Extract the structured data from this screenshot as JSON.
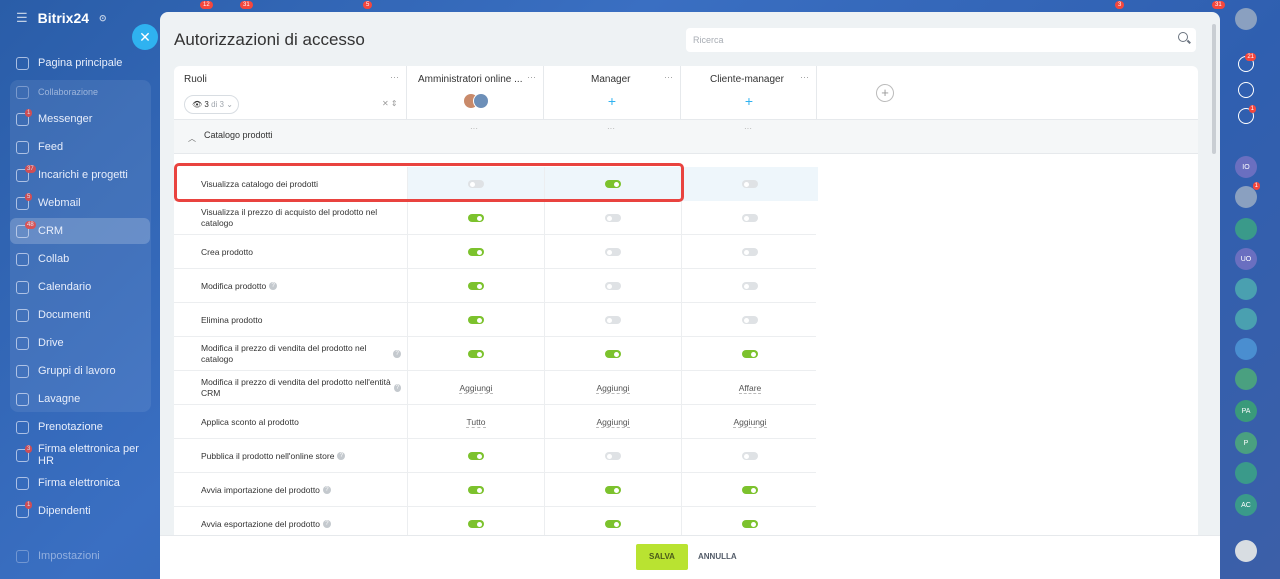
{
  "brand": {
    "name": "Bitrix24",
    "clock_mark": "⊙"
  },
  "nav": [
    {
      "label": "Pagina principale",
      "icon": "home-icon"
    },
    {
      "label": "Collaborazione",
      "icon": "collab-group-icon",
      "sub": true
    },
    {
      "label": "Messenger",
      "icon": "chat-icon",
      "badge": "1"
    },
    {
      "label": "Feed",
      "icon": "feed-icon"
    },
    {
      "label": "Incarichi e progetti",
      "icon": "tasks-icon",
      "badge": "37"
    },
    {
      "label": "Webmail",
      "icon": "mail-icon",
      "badge": "5"
    },
    {
      "label": "CRM",
      "icon": "crm-icon",
      "badge": "48",
      "active": true
    },
    {
      "label": "Collab",
      "icon": "collab-icon"
    },
    {
      "label": "Calendario",
      "icon": "calendar-icon"
    },
    {
      "label": "Documenti",
      "icon": "documents-icon"
    },
    {
      "label": "Drive",
      "icon": "drive-icon"
    },
    {
      "label": "Gruppi di lavoro",
      "icon": "groups-icon"
    },
    {
      "label": "Lavagne",
      "icon": "boards-icon"
    },
    {
      "label": "Prenotazione",
      "icon": "booking-icon"
    },
    {
      "label": "Firma elettronica per HR",
      "icon": "hr-sign-icon",
      "badge": "3"
    },
    {
      "label": "Firma elettronica",
      "icon": "sign-icon"
    },
    {
      "label": "Dipendenti",
      "icon": "employees-icon",
      "badge": "1"
    },
    {
      "label": "Impostazioni",
      "icon": "settings-icon",
      "dim": true
    }
  ],
  "topbar_badges": [
    "12",
    "31",
    "5",
    "3",
    "31"
  ],
  "panel": {
    "title": "Autorizzazioni di accesso",
    "search_placeholder": "Ricerca",
    "roles_header": "Ruoli",
    "roles_count": "3",
    "roles_of": "di 3",
    "columns": [
      {
        "label": "Amministratori online ...",
        "kind": "avatars"
      },
      {
        "label": "Manager",
        "kind": "add"
      },
      {
        "label": "Cliente-manager",
        "kind": "add"
      }
    ],
    "section": "Catalogo prodotti",
    "rows": [
      {
        "name": "Visualizza catalogo dei prodotti",
        "info": false,
        "values": [
          "off",
          "on",
          "off"
        ],
        "highlight": true
      },
      {
        "name": "Visualizza il prezzo di acquisto del prodotto nel catalogo",
        "info": false,
        "values": [
          "on",
          "off",
          "off"
        ]
      },
      {
        "name": "Crea prodotto",
        "info": false,
        "values": [
          "on",
          "off",
          "off"
        ]
      },
      {
        "name": "Modifica prodotto",
        "info": true,
        "values": [
          "on",
          "off",
          "off"
        ]
      },
      {
        "name": "Elimina prodotto",
        "info": false,
        "values": [
          "on",
          "off",
          "off"
        ]
      },
      {
        "name": "Modifica il prezzo di vendita del prodotto nel catalogo",
        "info": true,
        "values": [
          "on",
          "on",
          "on"
        ]
      },
      {
        "name": "Modifica il prezzo di vendita del prodotto nell'entità CRM",
        "info": true,
        "values": [
          "Aggiungi",
          "Aggiungi",
          "Affare"
        ]
      },
      {
        "name": "Applica sconto al prodotto",
        "info": false,
        "values": [
          "Tutto",
          "Aggiungi",
          "Aggiungi"
        ]
      },
      {
        "name": "Pubblica il prodotto nell'online store",
        "info": true,
        "values": [
          "on",
          "off",
          "off"
        ]
      },
      {
        "name": "Avvia importazione del prodotto",
        "info": true,
        "values": [
          "on",
          "on",
          "on"
        ]
      },
      {
        "name": "Avvia esportazione del prodotto",
        "info": true,
        "values": [
          "on",
          "on",
          "on"
        ]
      }
    ],
    "save_label": "SALVA",
    "cancel_label": "ANNULLA"
  },
  "rightbar": [
    {
      "icon": "user-avatar-icon",
      "badge": ""
    },
    {
      "icon": "bell-icon",
      "badge": "21"
    },
    {
      "icon": "copilot-icon",
      "badge": ""
    },
    {
      "icon": "chat-bubble-icon",
      "badge": "1"
    },
    {
      "icon": "user-initials-icon",
      "text": "IO"
    },
    {
      "icon": "user-avatar-icon",
      "badge": "1"
    },
    {
      "icon": "tasks-check-icon"
    },
    {
      "icon": "user-initials-icon",
      "text": "UO"
    },
    {
      "icon": "group-icon"
    },
    {
      "icon": "group-icon"
    },
    {
      "icon": "chat-group-icon"
    },
    {
      "icon": "group-icon"
    },
    {
      "icon": "user-initials-icon",
      "text": "PA"
    },
    {
      "icon": "user-initials-icon",
      "text": "P"
    },
    {
      "icon": "tasks-check-icon"
    },
    {
      "icon": "user-initials-icon",
      "text": "AC"
    },
    {
      "icon": "menu-icon"
    }
  ]
}
